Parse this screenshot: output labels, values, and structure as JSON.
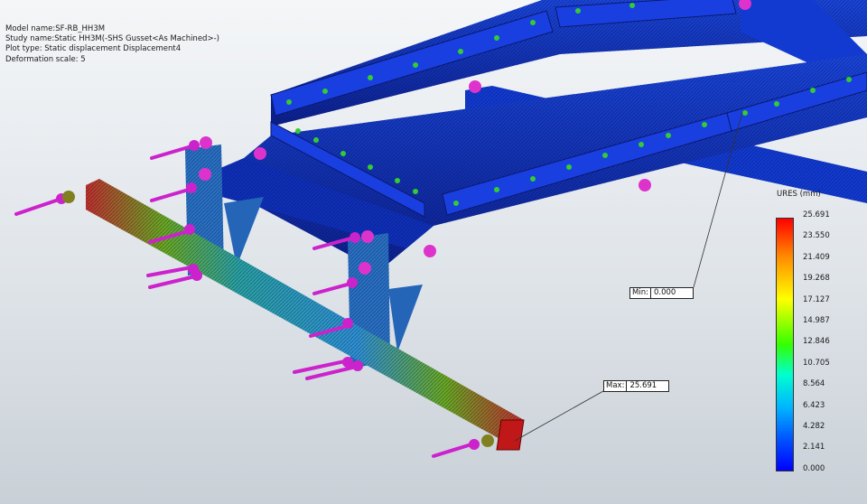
{
  "study_info": {
    "model_name": "Model name:SF-RB_HH3M",
    "study_name": "Study name:Static HH3M(-SHS Gusset<As Machined>-)",
    "plot_type": "Plot type: Static displacement Displacement4",
    "deformation_scale": "Deformation scale: 5"
  },
  "legend": {
    "title": "URES (mm)",
    "ticks": [
      "25.691",
      "23.550",
      "21.409",
      "19.268",
      "17.127",
      "14.987",
      "12.846",
      "10.705",
      "8.564",
      "6.423",
      "4.282",
      "2.141",
      "0.000"
    ]
  },
  "probes": {
    "min": {
      "label": "Min:",
      "value": "0.000"
    },
    "max": {
      "label": "Max:",
      "value": "25.691"
    }
  },
  "colors": {
    "frame_blue": "#1033c8",
    "max_red": "#d01a1a",
    "fixture_green": "#33cc33",
    "load_magenta": "#cc22cc"
  }
}
